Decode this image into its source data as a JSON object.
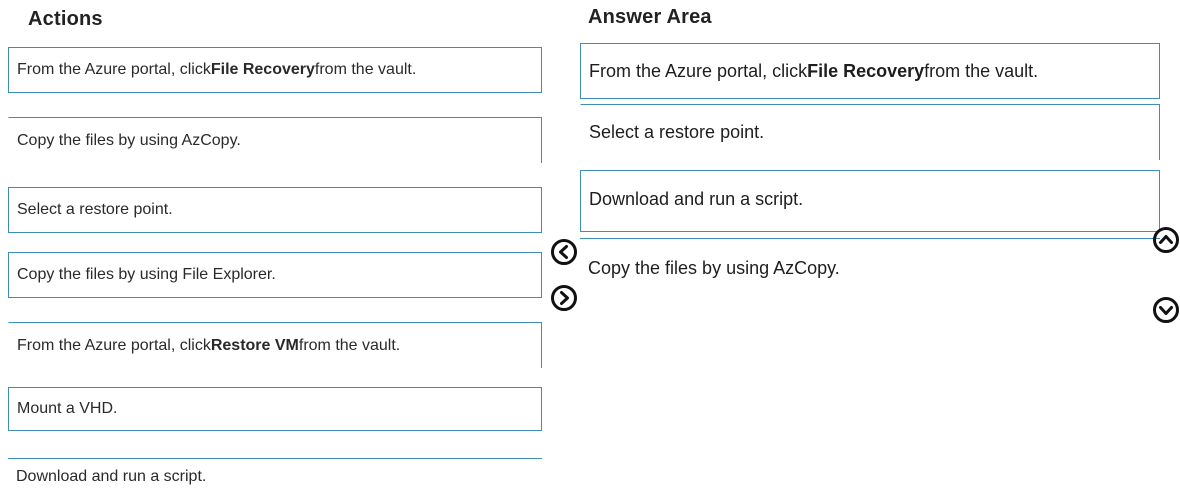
{
  "actions": {
    "heading": "Actions",
    "items": [
      {
        "pre": "From the Azure portal, click ",
        "bold": "File Recovery",
        "post": " from the vault."
      },
      {
        "pre": "Copy the files by using AzCopy.",
        "bold": "",
        "post": ""
      },
      {
        "pre": "Select a restore point.",
        "bold": "",
        "post": ""
      },
      {
        "pre": "Copy the files by using File Explorer.",
        "bold": "",
        "post": ""
      },
      {
        "pre": "From the Azure portal, click ",
        "bold": "Restore VM",
        "post": " from the vault."
      },
      {
        "pre": "Mount a VHD.",
        "bold": "",
        "post": ""
      },
      {
        "pre": "Download and run a script.",
        "bold": "",
        "post": ""
      }
    ]
  },
  "answer_area": {
    "heading": "Answer Area",
    "items": [
      {
        "pre": "From the Azure portal, click ",
        "bold": "File Recovery",
        "post": " from the vault."
      },
      {
        "pre": "Select a restore point.",
        "bold": "",
        "post": ""
      },
      {
        "pre": "Download and run a script.",
        "bold": "",
        "post": ""
      },
      {
        "pre": "Copy the files by using AzCopy.",
        "bold": "",
        "post": ""
      }
    ]
  },
  "controls": {
    "move_left_icon": "chevron-left-circle",
    "move_right_icon": "chevron-right-circle",
    "move_up_icon": "chevron-up-circle",
    "move_down_icon": "chevron-down-circle",
    "accent_color": "#3d8fb5"
  }
}
